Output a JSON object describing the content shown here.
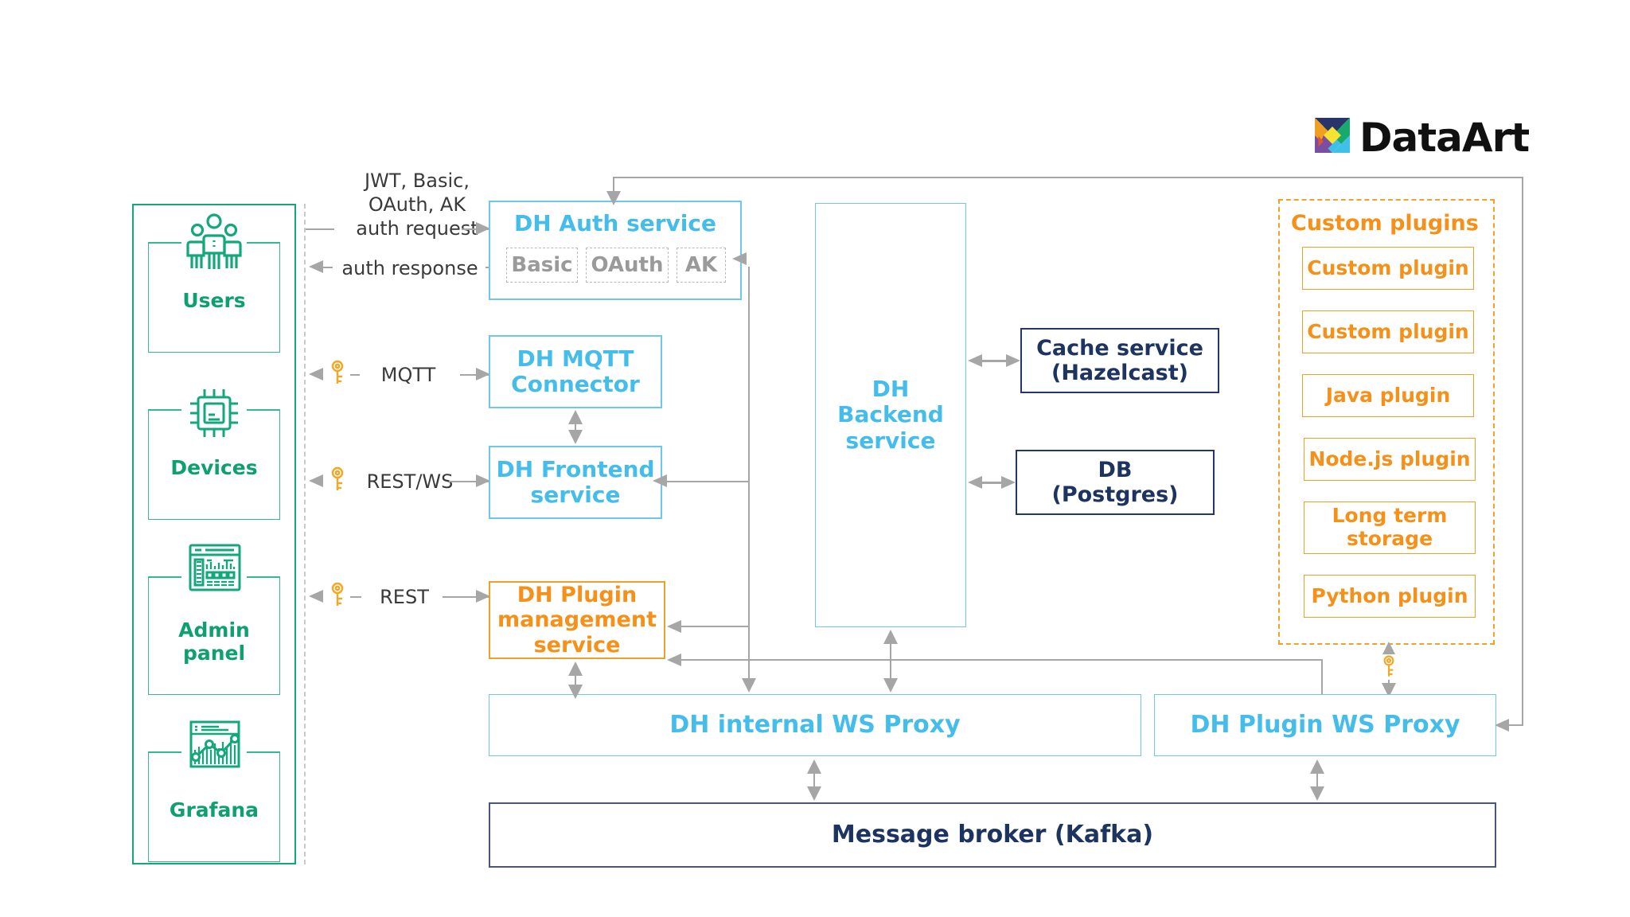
{
  "brand": {
    "name": "DataArt",
    "logo_icon": "dataart-logo-icon"
  },
  "clients": {
    "items": [
      {
        "label": "Users",
        "icon": "users-icon"
      },
      {
        "label": "Devices",
        "icon": "chip-icon"
      },
      {
        "label": "Admin panel",
        "icon": "dashboard-icon"
      },
      {
        "label": "Grafana",
        "icon": "analytics-chart-icon"
      }
    ]
  },
  "connections": {
    "auth_request": "JWT, Basic,\nOAuth, AK\nauth request",
    "auth_request_l1": "JWT, Basic,",
    "auth_request_l2": "OAuth, AK",
    "auth_request_l3": "auth request",
    "auth_response": "auth response",
    "mqtt": "MQTT",
    "rest_ws": "REST/WS",
    "rest": "REST",
    "key_icon": "key-icon"
  },
  "services": {
    "auth": {
      "title": "DH Auth service",
      "methods": [
        "Basic",
        "OAuth",
        "AK"
      ]
    },
    "mqtt_connector_l1": "DH MQTT",
    "mqtt_connector_l2": "Connector",
    "frontend_l1": "DH Frontend",
    "frontend_l2": "service",
    "plugin_mgmt_l1": "DH Plugin",
    "plugin_mgmt_l2": "management",
    "plugin_mgmt_l3": "service",
    "backend_l1": "DH",
    "backend_l2": "Backend",
    "backend_l3": "service",
    "cache_l1": "Cache service",
    "cache_l2": "(Hazelcast)",
    "db_l1": "DB",
    "db_l2": "(Postgres)",
    "internal_ws_proxy": "DH internal WS Proxy",
    "plugin_ws_proxy": "DH Plugin WS Proxy",
    "message_broker": "Message broker (Kafka)"
  },
  "plugins": {
    "title": "Custom plugins",
    "items": [
      {
        "label": "Custom plugin"
      },
      {
        "label": "Custom plugin"
      },
      {
        "label": "Java plugin"
      },
      {
        "label": "Node.js plugin"
      },
      {
        "label": "Long term",
        "label2": "storage"
      },
      {
        "label": "Python plugin"
      }
    ]
  },
  "colors": {
    "green": "#12a87a",
    "blue": "#45bdea",
    "orange": "#f59019",
    "navy": "#1d3461",
    "gray": "#a6a6a6"
  }
}
